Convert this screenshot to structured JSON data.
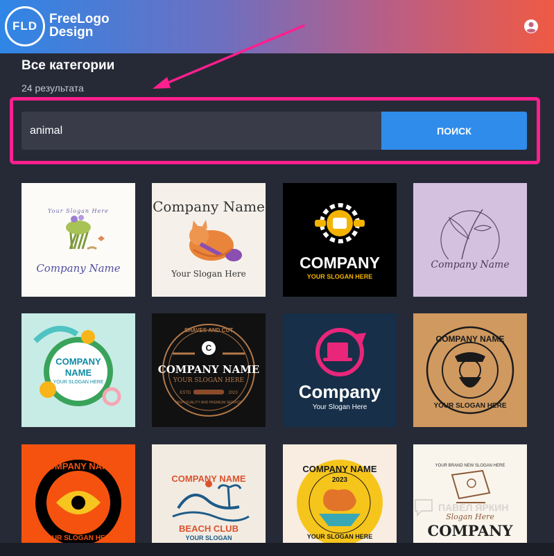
{
  "header": {
    "logo_badge": "FLD",
    "logo_line1": "FreeLogo",
    "logo_line2": "Design",
    "account_icon": "account-circle-icon"
  },
  "main": {
    "title": "Все категории",
    "result_count": "24 результата"
  },
  "search": {
    "value": "animal",
    "button_label": "ПОИСК"
  },
  "colors": {
    "header_gradient": [
      "#2f86e6",
      "#ef5a43"
    ],
    "highlight": "#ff1f8e",
    "search_button": "#2f8cea",
    "background": "#262a36"
  },
  "logos": [
    {
      "slogan": "Your Slogan Here",
      "name": "Company Name"
    },
    {
      "name": "Company Name",
      "slogan": "Your Slogan Here"
    },
    {
      "name": "COMPANY",
      "slogan": "YOUR SLOGAN HERE"
    },
    {
      "name": "Company Name"
    },
    {
      "name_line1": "COMPANY",
      "name_line2": "NAME",
      "slogan": "YOUR SLOGAN HERE"
    },
    {
      "top": "SHAVES AND CUT",
      "initial": "C",
      "name": "COMPANY NAME",
      "slogan": "YOUR SLOGAN HERE",
      "est": "ESTD",
      "year": "2023",
      "tagline": "HIGH QUALITY AND PREMIUM SERVICE"
    },
    {
      "name": "Company",
      "slogan": "Your Slogan Here"
    },
    {
      "name": "COMPANY NAME",
      "slogan": "YOUR SLOGAN HERE"
    },
    {
      "name": "COMPANY NAME",
      "slogan": "YOUR SLOGAN HERE"
    },
    {
      "name": "COMPANY NAME",
      "sub": "BEACH CLUB",
      "slogan": "YOUR SLOGAN"
    },
    {
      "name": "COMPANY NAME",
      "year": "2023",
      "slogan": "YOUR SLOGAN HERE"
    },
    {
      "top": "YOUR BRAND NEW SLOGAN HERE",
      "slogan": "Slogan Here",
      "name": "COMPANY"
    }
  ],
  "watermark": "ПАВЕЛ ЯРКИН"
}
